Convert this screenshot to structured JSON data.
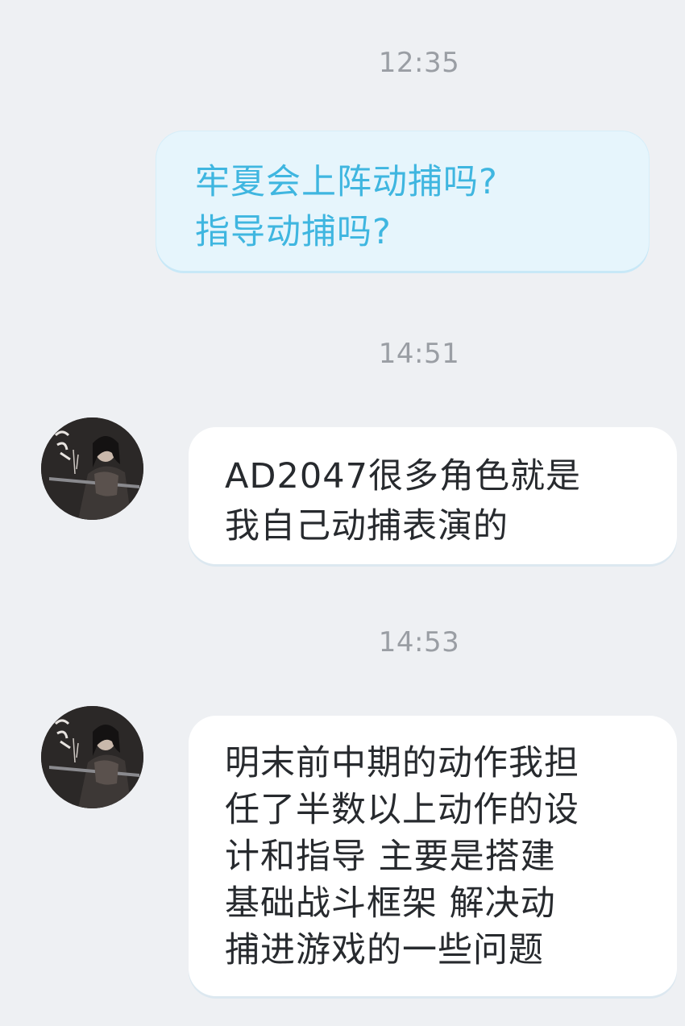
{
  "conversation": {
    "timestamps": [
      "12:35",
      "14:51",
      "14:53"
    ],
    "messages": [
      {
        "direction": "sent",
        "lines": [
          "牢夏会上阵动捕吗?",
          "指导动捕吗?"
        ]
      },
      {
        "direction": "received",
        "lines": [
          "AD2047很多角色就是",
          "我自己动捕表演的"
        ]
      },
      {
        "direction": "received",
        "lines": [
          "明末前中期的动作我担",
          "任了半数以上动作的设",
          "计和指导 主要是搭建",
          "基础战斗框架 解决动",
          "捕进游戏的一些问题"
        ]
      }
    ]
  },
  "colors": {
    "background": "#eef0f3",
    "sent_bubble": "#e6f5fc",
    "sent_text": "#3fb6e0",
    "received_bubble": "#ffffff",
    "received_text": "#272a2e",
    "timestamp": "#9a9ea4"
  },
  "icons": {
    "avatar": "warrior-portrait-avatar"
  }
}
